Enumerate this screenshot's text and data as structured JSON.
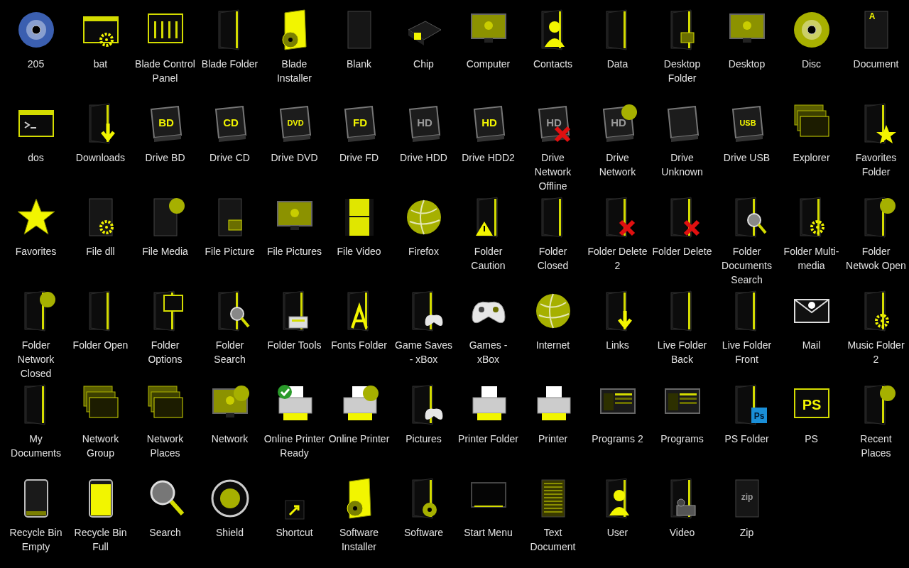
{
  "icons": [
    {
      "label": "205",
      "kind": "disc",
      "color": "#3b5fb0"
    },
    {
      "label": "bat",
      "kind": "console",
      "overlay": {
        "kind": "gear"
      }
    },
    {
      "label": "Blade Control Panel",
      "kind": "panel"
    },
    {
      "label": "Blade Folder",
      "kind": "folder"
    },
    {
      "label": "Blade Installer",
      "kind": "installer"
    },
    {
      "label": "Blank",
      "kind": "page"
    },
    {
      "label": "Chip",
      "kind": "chip"
    },
    {
      "label": "Computer",
      "kind": "monitor"
    },
    {
      "label": "Contacts",
      "kind": "folder",
      "overlay": {
        "kind": "user"
      }
    },
    {
      "label": "Data",
      "kind": "folder"
    },
    {
      "label": "Desktop Folder",
      "kind": "folder",
      "overlay": {
        "kind": "screen"
      }
    },
    {
      "label": "Desktop",
      "kind": "monitor"
    },
    {
      "label": "Disc",
      "kind": "disc",
      "color": "#a8b000"
    },
    {
      "label": "Document",
      "kind": "page",
      "glyph": "A"
    },
    {
      "label": "dos",
      "kind": "console",
      "overlay": {
        "kind": "prompt"
      }
    },
    {
      "label": "Downloads",
      "kind": "folder",
      "overlay": {
        "kind": "arrow"
      }
    },
    {
      "label": "Drive BD",
      "kind": "drive",
      "glyph": "BD",
      "color": "#f2f500"
    },
    {
      "label": "Drive CD",
      "kind": "drive",
      "glyph": "CD",
      "color": "#f2f500"
    },
    {
      "label": "Drive DVD",
      "kind": "drive",
      "glyph": "DVD",
      "color": "#f2f500"
    },
    {
      "label": "Drive FD",
      "kind": "drive",
      "glyph": "FD",
      "color": "#f2f500"
    },
    {
      "label": "Drive HDD",
      "kind": "drive",
      "glyph": "HD",
      "color": "#999999"
    },
    {
      "label": "Drive HDD2",
      "kind": "drive",
      "glyph": "HD",
      "color": "#f2f500"
    },
    {
      "label": "Drive Network Offline",
      "kind": "drive",
      "glyph": "HD",
      "color": "#999999",
      "overlay": {
        "kind": "cross"
      }
    },
    {
      "label": "Drive Network",
      "kind": "drive",
      "glyph": "HD",
      "color": "#999999",
      "overlay": {
        "kind": "globe"
      }
    },
    {
      "label": "Drive Unknown",
      "kind": "drive"
    },
    {
      "label": "Drive USB",
      "kind": "drive",
      "glyph": "USB",
      "color": "#f2f500"
    },
    {
      "label": "Explorer",
      "kind": "stack"
    },
    {
      "label": "Favorites Folder",
      "kind": "folder",
      "overlay": {
        "kind": "star"
      }
    },
    {
      "label": "Favorites",
      "kind": "star"
    },
    {
      "label": "File dll",
      "kind": "page",
      "overlay": {
        "kind": "gear"
      }
    },
    {
      "label": "File Media",
      "kind": "page",
      "overlay": {
        "kind": "globe"
      }
    },
    {
      "label": "File Picture",
      "kind": "page",
      "overlay": {
        "kind": "screen"
      }
    },
    {
      "label": "File Pictures",
      "kind": "monitor"
    },
    {
      "label": "File Video",
      "kind": "film"
    },
    {
      "label": "Firefox",
      "kind": "globe"
    },
    {
      "label": "Folder Caution",
      "kind": "folder",
      "overlay": {
        "kind": "warning"
      }
    },
    {
      "label": "Folder Closed",
      "kind": "folder"
    },
    {
      "label": "Folder Delete 2",
      "kind": "folder",
      "overlay": {
        "kind": "cross"
      }
    },
    {
      "label": "Folder Delete",
      "kind": "folder",
      "overlay": {
        "kind": "cross"
      }
    },
    {
      "label": "Folder Documents Search",
      "kind": "folder",
      "overlay": {
        "kind": "magnifier"
      }
    },
    {
      "label": "Folder Multi-media",
      "kind": "folder",
      "overlay": {
        "kind": "gear"
      }
    },
    {
      "label": "Folder Netwok Open",
      "kind": "folder",
      "overlay": {
        "kind": "globe"
      }
    },
    {
      "label": "Folder Network Closed",
      "kind": "folder",
      "overlay": {
        "kind": "globe"
      }
    },
    {
      "label": "Folder Open",
      "kind": "folder"
    },
    {
      "label": "Folder Options",
      "kind": "folder",
      "overlay": {
        "kind": "panel"
      }
    },
    {
      "label": "Folder Search",
      "kind": "folder",
      "overlay": {
        "kind": "magnifier"
      }
    },
    {
      "label": "Folder Tools",
      "kind": "folder",
      "overlay": {
        "kind": "tools"
      }
    },
    {
      "label": "Fonts Folder",
      "kind": "folder",
      "overlay": {
        "kind": "letter"
      }
    },
    {
      "label": "Game Saves - xBox",
      "kind": "folder",
      "overlay": {
        "kind": "gamepad"
      }
    },
    {
      "label": "Games - xBox",
      "kind": "gamepad"
    },
    {
      "label": "Internet",
      "kind": "globe"
    },
    {
      "label": "Links",
      "kind": "folder",
      "overlay": {
        "kind": "arrow"
      }
    },
    {
      "label": "Live Folder Back",
      "kind": "folder"
    },
    {
      "label": "Live Folder Front",
      "kind": "folder"
    },
    {
      "label": "Mail",
      "kind": "mail"
    },
    {
      "label": "Music Folder 2",
      "kind": "folder",
      "overlay": {
        "kind": "gear"
      }
    },
    {
      "label": "My Documents",
      "kind": "folder"
    },
    {
      "label": "Network Group",
      "kind": "stack"
    },
    {
      "label": "Network Places",
      "kind": "stack"
    },
    {
      "label": "Network",
      "kind": "monitor",
      "overlay": {
        "kind": "globe"
      }
    },
    {
      "label": "Online Printer Ready",
      "kind": "printer",
      "overlay": {
        "kind": "check"
      }
    },
    {
      "label": "Online Printer",
      "kind": "printer",
      "overlay": {
        "kind": "globe"
      }
    },
    {
      "label": "Pictures",
      "kind": "folder",
      "overlay": {
        "kind": "gamepad"
      }
    },
    {
      "label": "Printer Folder",
      "kind": "printer"
    },
    {
      "label": "Printer",
      "kind": "printer"
    },
    {
      "label": "Programs 2",
      "kind": "window"
    },
    {
      "label": "Programs",
      "kind": "window"
    },
    {
      "label": "PS Folder",
      "kind": "folder",
      "overlay": {
        "kind": "ps"
      },
      "glyph": "Ps"
    },
    {
      "label": "PS",
      "kind": "panel",
      "glyph": "PS"
    },
    {
      "label": "Recent Places",
      "kind": "folder",
      "overlay": {
        "kind": "globe"
      }
    },
    {
      "label": "Recycle Bin Empty",
      "kind": "bin",
      "full": false
    },
    {
      "label": "Recycle Bin Full",
      "kind": "bin",
      "full": true
    },
    {
      "label": "Search",
      "kind": "magnifier"
    },
    {
      "label": "Shield",
      "kind": "shield"
    },
    {
      "label": "Shortcut",
      "kind": "shortcut"
    },
    {
      "label": "Software Installer",
      "kind": "installer"
    },
    {
      "label": "Software",
      "kind": "folder",
      "overlay": {
        "kind": "disc"
      }
    },
    {
      "label": "Start Menu",
      "kind": "startmenu"
    },
    {
      "label": "Text Document",
      "kind": "notepage"
    },
    {
      "label": "User",
      "kind": "folder",
      "overlay": {
        "kind": "user"
      }
    },
    {
      "label": "Video",
      "kind": "folder",
      "overlay": {
        "kind": "film"
      }
    },
    {
      "label": "Zip",
      "kind": "page",
      "glyph": "zip"
    }
  ]
}
